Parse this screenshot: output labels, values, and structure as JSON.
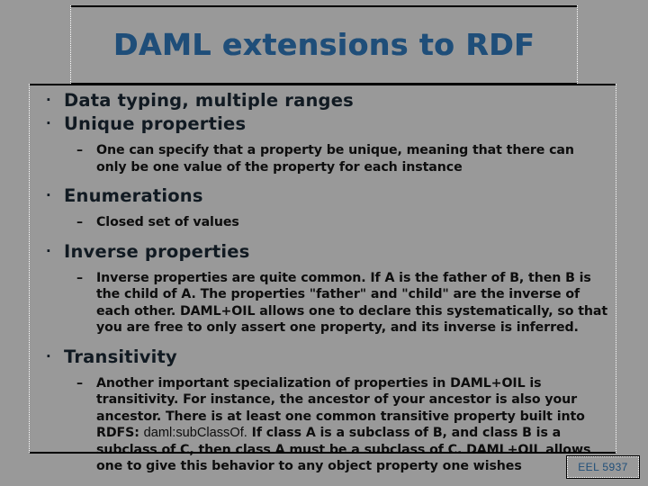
{
  "slide": {
    "background_color": "#999999",
    "title": "DAML extensions to RDF",
    "title_color": "#1F4E79",
    "body_text_color": "#111a22",
    "footer": {
      "label": "EEL 5937"
    },
    "bullets": [
      {
        "level": 1,
        "marker": "·",
        "text": "Data typing, multiple ranges"
      },
      {
        "level": 1,
        "marker": "·",
        "text": "Unique properties"
      },
      {
        "level": 2,
        "marker": "–",
        "text": "One can specify that a property be unique, meaning that there can only be one value of the property for each instance"
      },
      {
        "level": 1,
        "marker": "·",
        "text": "Enumerations"
      },
      {
        "level": 2,
        "marker": "–",
        "text": "Closed set of values"
      },
      {
        "level": 1,
        "marker": "·",
        "text": "Inverse properties"
      },
      {
        "level": 2,
        "marker": "–",
        "text": "Inverse properties are quite common. If A is the father of B, then B is the child of A. The properties \"father\" and \"child\" are the inverse of each other. DAML+OIL allows one to declare this systematically, so that you are free to only assert one property, and its inverse is inferred."
      },
      {
        "level": 1,
        "marker": "·",
        "text": "Transitivity"
      },
      {
        "level": 2,
        "marker": "–",
        "text_part_1": "Another important specialization of properties in DAML+OIL is transitivity. For instance, the ancestor of your ancestor is also your ancestor. There is at least one common transitive property built into RDFS:",
        "term": "daml:subClassOf.",
        "text_part_2": "If class A is a subclass of B, and class B is a subclass of C, then class A must be a subclass of C. DAML+OIL allows one to give this behavior to any object property one wishes"
      }
    ]
  }
}
